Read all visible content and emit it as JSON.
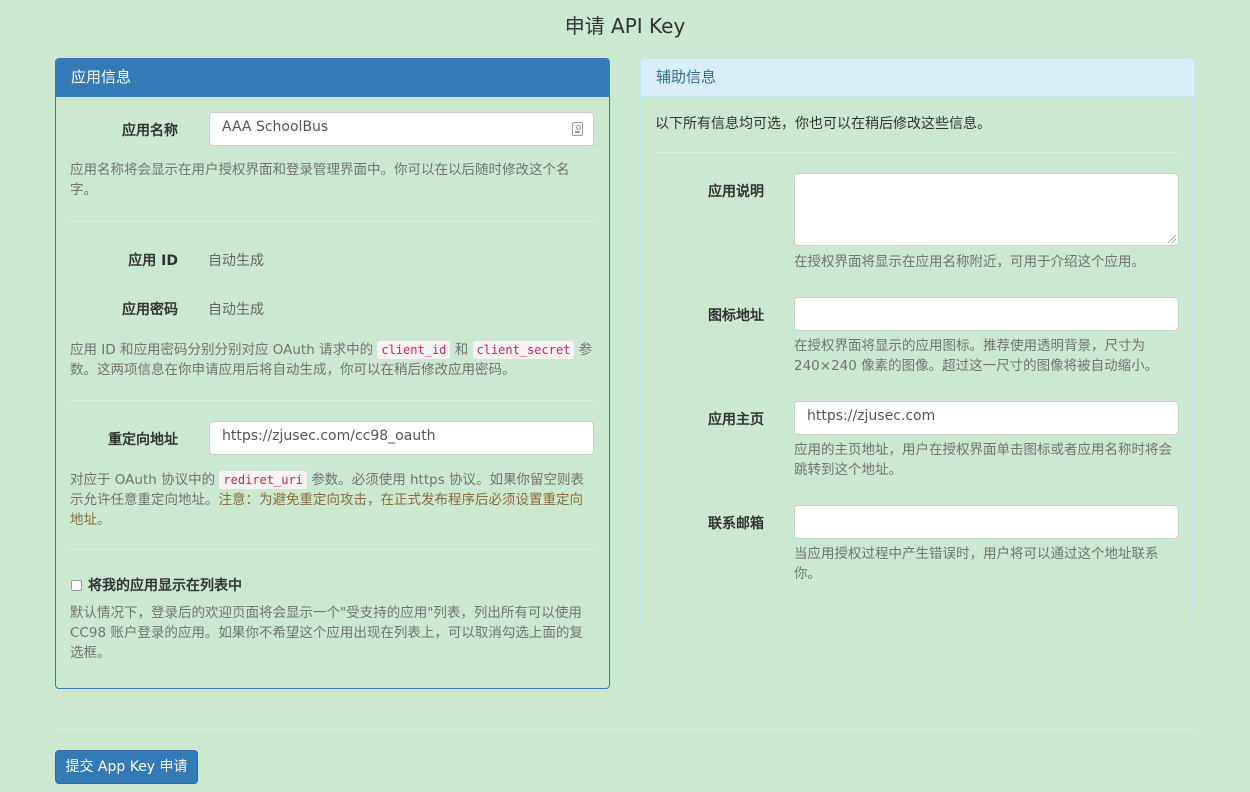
{
  "page_title": "申请 API Key",
  "left_panel": {
    "heading": "应用信息",
    "app_name_label": "应用名称",
    "app_name_value": "AAA SchoolBus",
    "app_name_help": "应用名称将会显示在用户授权界面和登录管理界面中。你可以在以后随时修改这个名字。",
    "app_id_label": "应用 ID",
    "app_id_value": "自动生成",
    "app_secret_label": "应用密码",
    "app_secret_value": "自动生成",
    "id_help_prefix": "应用 ID 和应用密码分别分别对应 OAuth 请求中的",
    "id_help_code1": "client_id",
    "id_help_and": "和",
    "id_help_code2": "client_secret",
    "id_help_suffix": "参数。这两项信息在你申请应用后将自动生成，你可以在稍后修改应用密码。",
    "redirect_label": "重定向地址",
    "redirect_value": "https://zjusec.com/cc98_oauth",
    "redirect_help_prefix": "对应于 OAuth 协议中的",
    "redirect_help_code": "rediret_uri",
    "redirect_help_suffix": "参数。必须使用 https 协议。如果你留空则表示允许任意重定向地址。",
    "redirect_warning": "注意：为避免重定向攻击，在正式发布程序后必须设置重定向地址",
    "redirect_period": "。",
    "show_in_list_label": "将我的应用显示在列表中",
    "show_in_list_checked": false,
    "show_in_list_help": "默认情况下，登录后的欢迎页面将会显示一个\"受支持的应用\"列表，列出所有可以使用 CC98 账户登录的应用。如果你不希望这个应用出现在列表上，可以取消勾选上面的复选框。"
  },
  "right_panel": {
    "heading": "辅助信息",
    "intro": "以下所有信息均可选，你也可以在稍后修改这些信息。",
    "description_label": "应用说明",
    "description_value": "",
    "description_help": "在授权界面将显示在应用名称附近，可用于介绍这个应用。",
    "icon_label": "图标地址",
    "icon_value": "",
    "icon_help": "在授权界面将显示的应用图标。推荐使用透明背景，尺寸为 240×240 像素的图像。超过这一尺寸的图像将被自动缩小。",
    "homepage_label": "应用主页",
    "homepage_value": "https://zjusec.com",
    "homepage_help": "应用的主页地址，用户在授权界面单击图标或者应用名称时将会跳转到这个地址。",
    "email_label": "联系邮箱",
    "email_value": "",
    "email_help": "当应用授权过程中产生错误时，用户将可以通过这个地址联系你。"
  },
  "submit_label": "提交 App Key 申请",
  "colors": {
    "background": "#cce8d0",
    "primary": "#337ab7",
    "info_heading_bg": "#d9edf7",
    "info_heading_text": "#31708f",
    "warning_text": "#8a6d3b",
    "code_text": "#c7254e"
  }
}
